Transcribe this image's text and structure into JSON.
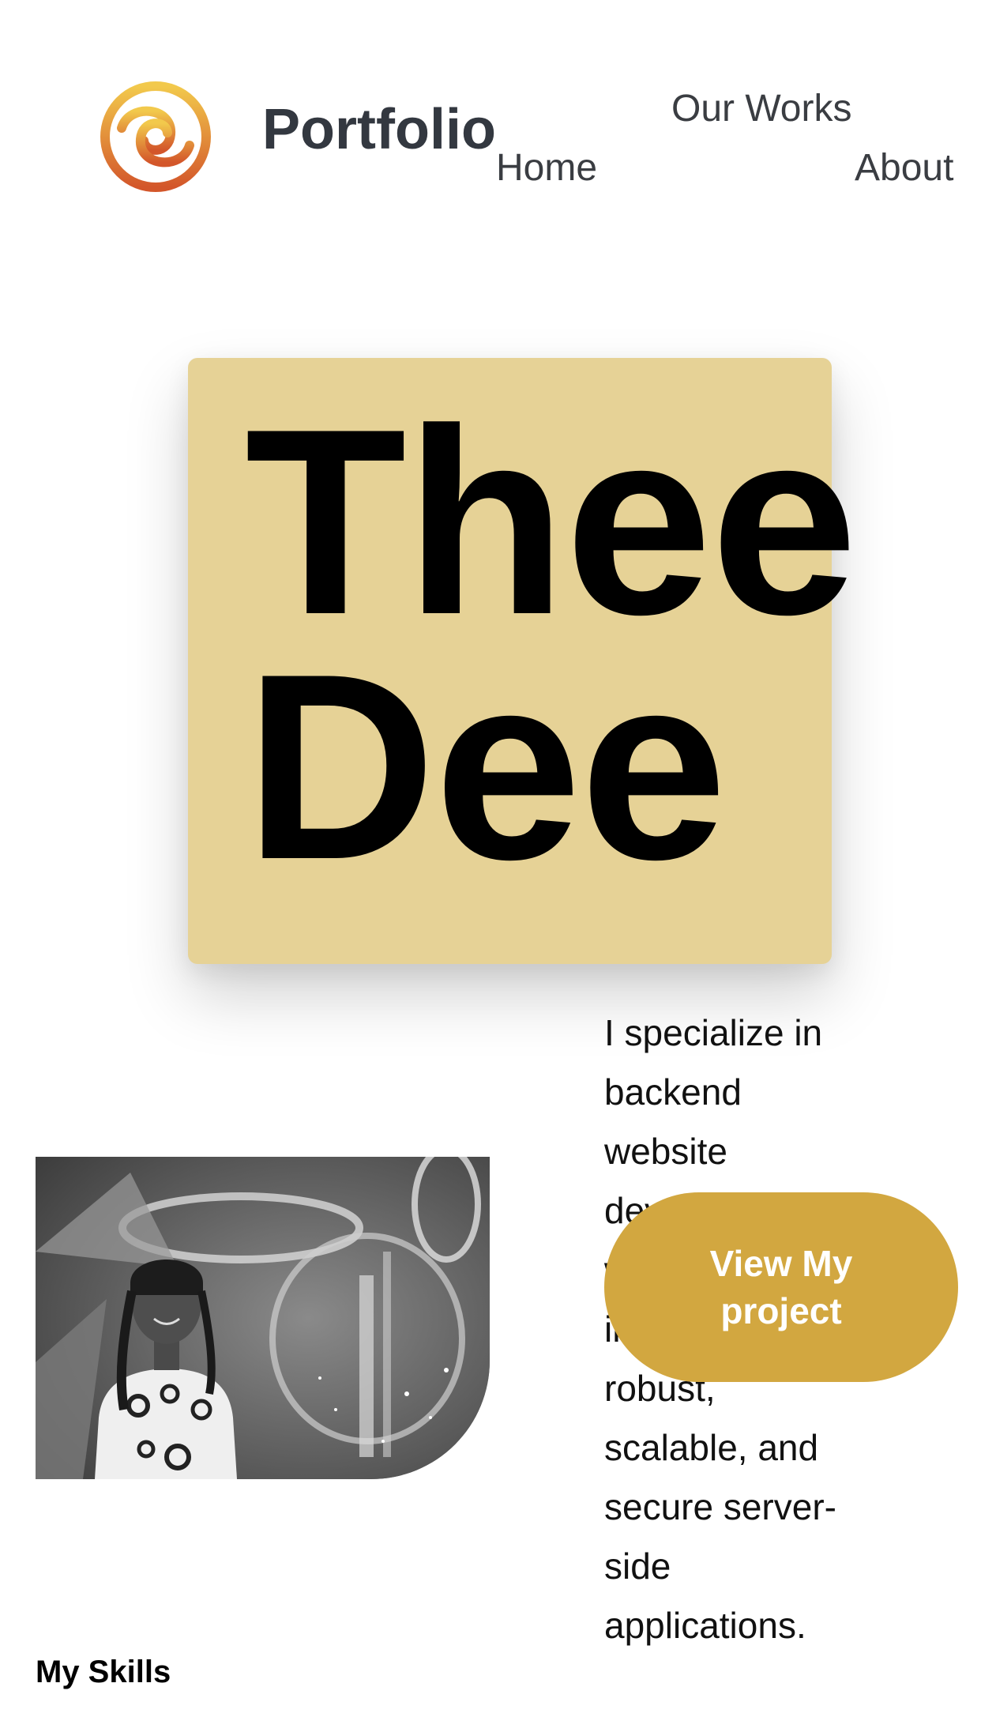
{
  "header": {
    "brand": "Portfolio",
    "logo_icon": "swirl-logo-icon",
    "nav": [
      {
        "label": "Home"
      },
      {
        "label": "Our Works"
      },
      {
        "label": "About"
      }
    ]
  },
  "hero": {
    "title_line1": "Thee",
    "title_line2": "Dee",
    "card_color": "#e6d296"
  },
  "intro": {
    "text": "I specialize in backend website development, with expertise in creating robust, scalable, and secure server-side applications."
  },
  "cta": {
    "label": "View My project",
    "color": "#d2a740"
  },
  "profile_photo": {
    "alt": "profile-photo"
  },
  "skills": {
    "heading": "My Skills"
  }
}
